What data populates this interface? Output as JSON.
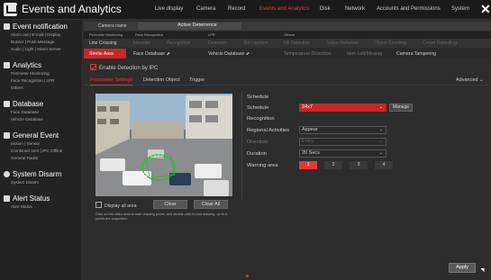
{
  "app": {
    "title": "Events and Analytics"
  },
  "topnav": [
    {
      "label": "Live display",
      "active": false
    },
    {
      "label": "Camera",
      "active": false
    },
    {
      "label": "Record",
      "active": false
    },
    {
      "label": "Events and Analytics",
      "active": true
    },
    {
      "label": "Disk",
      "active": false
    },
    {
      "label": "Network",
      "active": false
    },
    {
      "label": "Accounts and Permissions",
      "active": false
    },
    {
      "label": "System",
      "active": false
    }
  ],
  "sidebar": {
    "groups": [
      {
        "title": "Event notification",
        "icon": "bell-icon",
        "items": [
          "Alarm out | E-mail | Display",
          "Buzzer | Push Message",
          "Audio | Light | Alarm Server"
        ]
      },
      {
        "title": "Analytics",
        "icon": "analytics-icon",
        "items": [
          "Perimeter Monitoring",
          "Face Recognition | LPR",
          "Others"
        ]
      },
      {
        "title": "Database",
        "icon": "database-icon",
        "items": [
          "Face Database",
          "Vehicle Database"
        ]
      },
      {
        "title": "General Event",
        "icon": "event-icon",
        "items": [
          "Motion | Sensor",
          "Combined Alert | IPC Offline",
          "General Faults"
        ]
      },
      {
        "title": "System Disarm",
        "icon": "shield-icon",
        "items": [
          "System Disarm"
        ]
      },
      {
        "title": "Alert Status",
        "icon": "alert-icon",
        "items": [
          "Alert Status"
        ]
      }
    ]
  },
  "camera": {
    "label": "Camera name",
    "value": "Active Deterrence"
  },
  "group_labels": [
    "Perimeter Monitoring",
    "Face Recognition",
    "LPR",
    "Others"
  ],
  "feature_tabs_row1": [
    "Line Crossing",
    "Intrusion",
    "Recognition",
    "Detection",
    "Recognition",
    "Fill Detection",
    "Video Metadata",
    "Object Counting",
    "Crowd Delimiting"
  ],
  "feature_tabs_row2": [
    "Sterile Area",
    "Face Database",
    "Vehicle Database",
    "Temperature Detection",
    "Item Left/Missing",
    "Camera Tampering"
  ],
  "enable_label": "Enable Detection by IPC",
  "subtabs": [
    "Parameter Settings",
    "Detection Object",
    "Trigger"
  ],
  "advanced_label": "Advanced",
  "video_controls": {
    "display_all": "Display all area",
    "clear": "Clear",
    "clear_all": "Clear All"
  },
  "hint": "Click on the video area to start drawing points, and double-click to end drawing, up to 8 points are supported.",
  "panel": {
    "schedule_section": "Schedule",
    "schedule_label": "Schedule",
    "schedule_value": "24x7",
    "manage_label": "Manage",
    "recognition_section": "Recognition",
    "regional_label": "Regional Activities",
    "regional_value": "Appear",
    "direction_label": "Direction",
    "direction_value": "Entry",
    "duration_label": "Duration",
    "duration_value": "20 Secs",
    "warning_label": "Warning area",
    "warning_areas": [
      "1",
      "2",
      "3",
      "4"
    ]
  },
  "apply_label": "Apply",
  "colors": {
    "accent": "#e53935",
    "background": "#2b2b2b"
  }
}
